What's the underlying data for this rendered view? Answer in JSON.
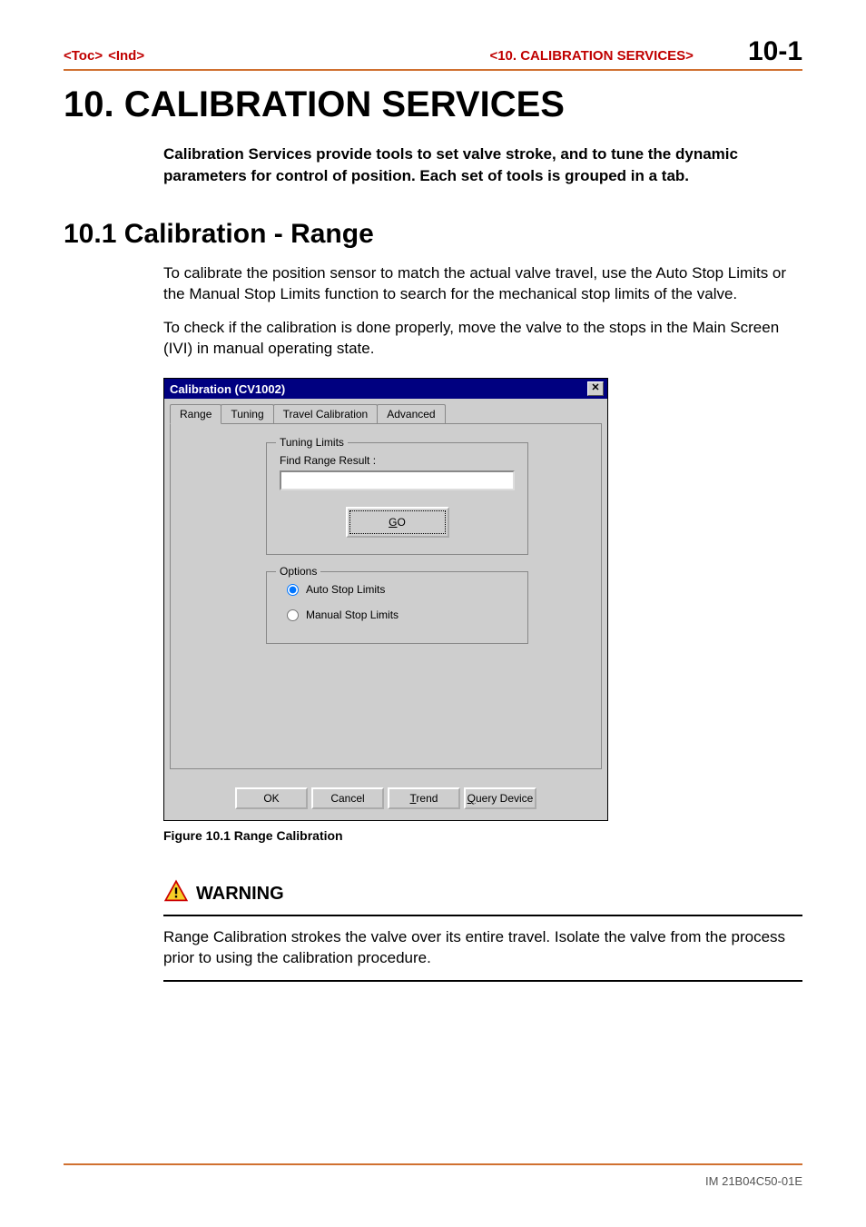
{
  "header": {
    "toc": "<Toc>",
    "ind": "<Ind>",
    "section_label": "<10.  CALIBRATION SERVICES>",
    "page_number": "10-1"
  },
  "title": "10.   CALIBRATION SERVICES",
  "intro": "Calibration Services provide tools to set valve stroke, and to tune the dynamic parameters for control of position.  Each set of tools is grouped in a tab.",
  "subsection": {
    "heading": "10.1  Calibration - Range",
    "p1": "To calibrate the position sensor to match the actual valve travel, use the Auto Stop Limits or the Manual Stop Limits function to search for the mechanical stop limits of the valve.",
    "p2": "To check if the calibration is done properly, move the valve to the stops in the Main Screen (IVI) in manual operating state."
  },
  "dialog": {
    "title": "Calibration (CV1002)",
    "close": "✕",
    "tabs": [
      "Range",
      "Tuning",
      "Travel Calibration",
      "Advanced"
    ],
    "tuning_limits": {
      "legend": "Tuning Limits",
      "find_range_label": "Find Range Result :",
      "find_range_value": "",
      "go_label": "GO",
      "go_underline": "G",
      "go_rest": "O"
    },
    "options": {
      "legend": "Options",
      "auto": "Auto Stop Limits",
      "manual": "Manual Stop Limits"
    },
    "buttons": {
      "ok": "OK",
      "cancel": "Cancel",
      "trend_u": "T",
      "trend_rest": "rend",
      "query_u": "Q",
      "query_rest": "uery Device"
    }
  },
  "figure_caption": "Figure 10.1 Range Calibration",
  "warning": {
    "title": "WARNING",
    "text": "Range Calibration strokes the valve over its entire travel.  Isolate the valve from the process prior to using the calibration procedure."
  },
  "footer": {
    "doc_id": "IM 21B04C50-01E"
  }
}
